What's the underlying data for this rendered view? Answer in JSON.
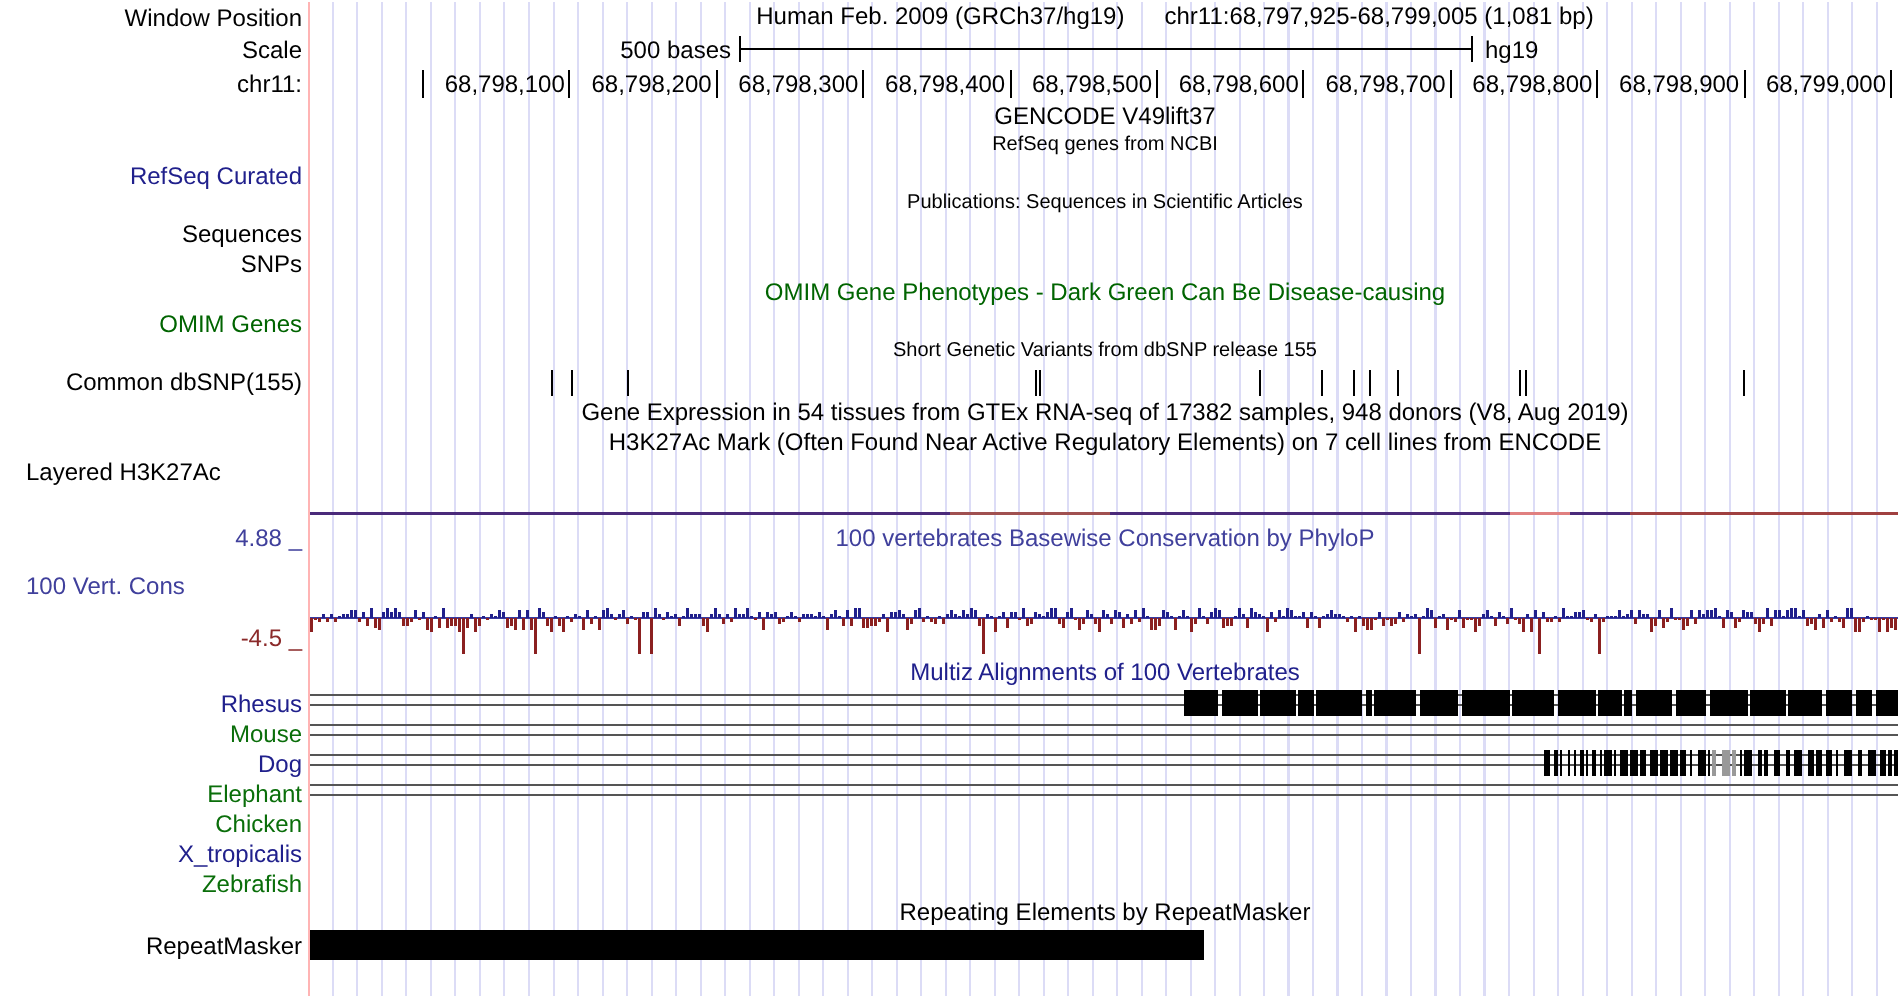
{
  "header": {
    "position_label": "Window Position",
    "assembly_title": "Human Feb. 2009 (GRCh37/hg19)",
    "position": "chr11:68,797,925-68,799,005 (1,081 bp)",
    "scale_label": "Scale",
    "scale_text": "500 bases",
    "scale_db": "hg19",
    "chrom_label": "chr11:",
    "ruler_labels": [
      "68,798,100",
      "68,798,200",
      "68,798,300",
      "68,798,400",
      "68,798,500",
      "68,798,600",
      "68,798,700",
      "68,798,800",
      "68,798,900",
      "68,799,000"
    ]
  },
  "rows": [
    {
      "kind": "title",
      "text": "GENCODE V49lift37",
      "color": "#000000"
    },
    {
      "kind": "note",
      "text": "RefSeq genes from NCBI",
      "color": "#000000"
    },
    {
      "kind": "label",
      "label": "RefSeq Curated",
      "color": "#20208c"
    },
    {
      "kind": "note",
      "text": "Publications: Sequences in Scientific Articles",
      "color": "#000000"
    },
    {
      "kind": "label",
      "label": "Sequences",
      "color": "#000000"
    },
    {
      "kind": "label",
      "label": "SNPs",
      "color": "#000000"
    },
    {
      "kind": "title",
      "text": "OMIM Gene Phenotypes - Dark Green Can Be Disease-causing",
      "color": "#006400"
    },
    {
      "kind": "label",
      "label": "OMIM Genes",
      "color": "#006400"
    },
    {
      "kind": "note",
      "text": "Short Genetic Variants from dbSNP release 155",
      "color": "#000000"
    },
    {
      "kind": "snp",
      "label": "Common dbSNP(155)",
      "color": "#000000"
    },
    {
      "kind": "title",
      "text": "Gene Expression in 54 tissues from GTEx RNA-seq of 17382 samples, 948 donors (V8, Aug 2019)",
      "color": "#000000"
    },
    {
      "kind": "title",
      "text": "H3K27Ac Mark (Often Found Near Active Regulatory Elements) on 7 cell lines from ENCODE",
      "color": "#000000"
    },
    {
      "kind": "layered",
      "label": "Layered H3K27Ac",
      "color": "#000000"
    },
    {
      "kind": "conservation",
      "title": "100 vertebrates Basewise Conservation by PhyloP",
      "label": "100 Vert. Cons",
      "max_label": "4.88 _",
      "min_label": "-4.5 _",
      "color": "#40409c"
    },
    {
      "kind": "title",
      "text": "Multiz Alignments of 100 Vertebrates",
      "color": "#20208c"
    },
    {
      "kind": "blocks",
      "label": "Rhesus",
      "color": "#20208c"
    },
    {
      "kind": "aligned",
      "label": "Mouse",
      "color": "#0a6e0a"
    },
    {
      "kind": "sparse",
      "label": "Dog",
      "color": "#20208c"
    },
    {
      "kind": "aligned",
      "label": "Elephant",
      "color": "#0a6e0a"
    },
    {
      "kind": "unaligned",
      "label": "Chicken",
      "color": "#0a6e0a"
    },
    {
      "kind": "unaligned",
      "label": "X_tropicalis",
      "color": "#20208c"
    },
    {
      "kind": "unaligned",
      "label": "Zebrafish",
      "color": "#0a6e0a"
    },
    {
      "kind": "title",
      "text": "Repeating Elements by RepeatMasker",
      "color": "#000000"
    },
    {
      "kind": "repeat",
      "label": "RepeatMasker",
      "color": "#000000"
    }
  ]
}
